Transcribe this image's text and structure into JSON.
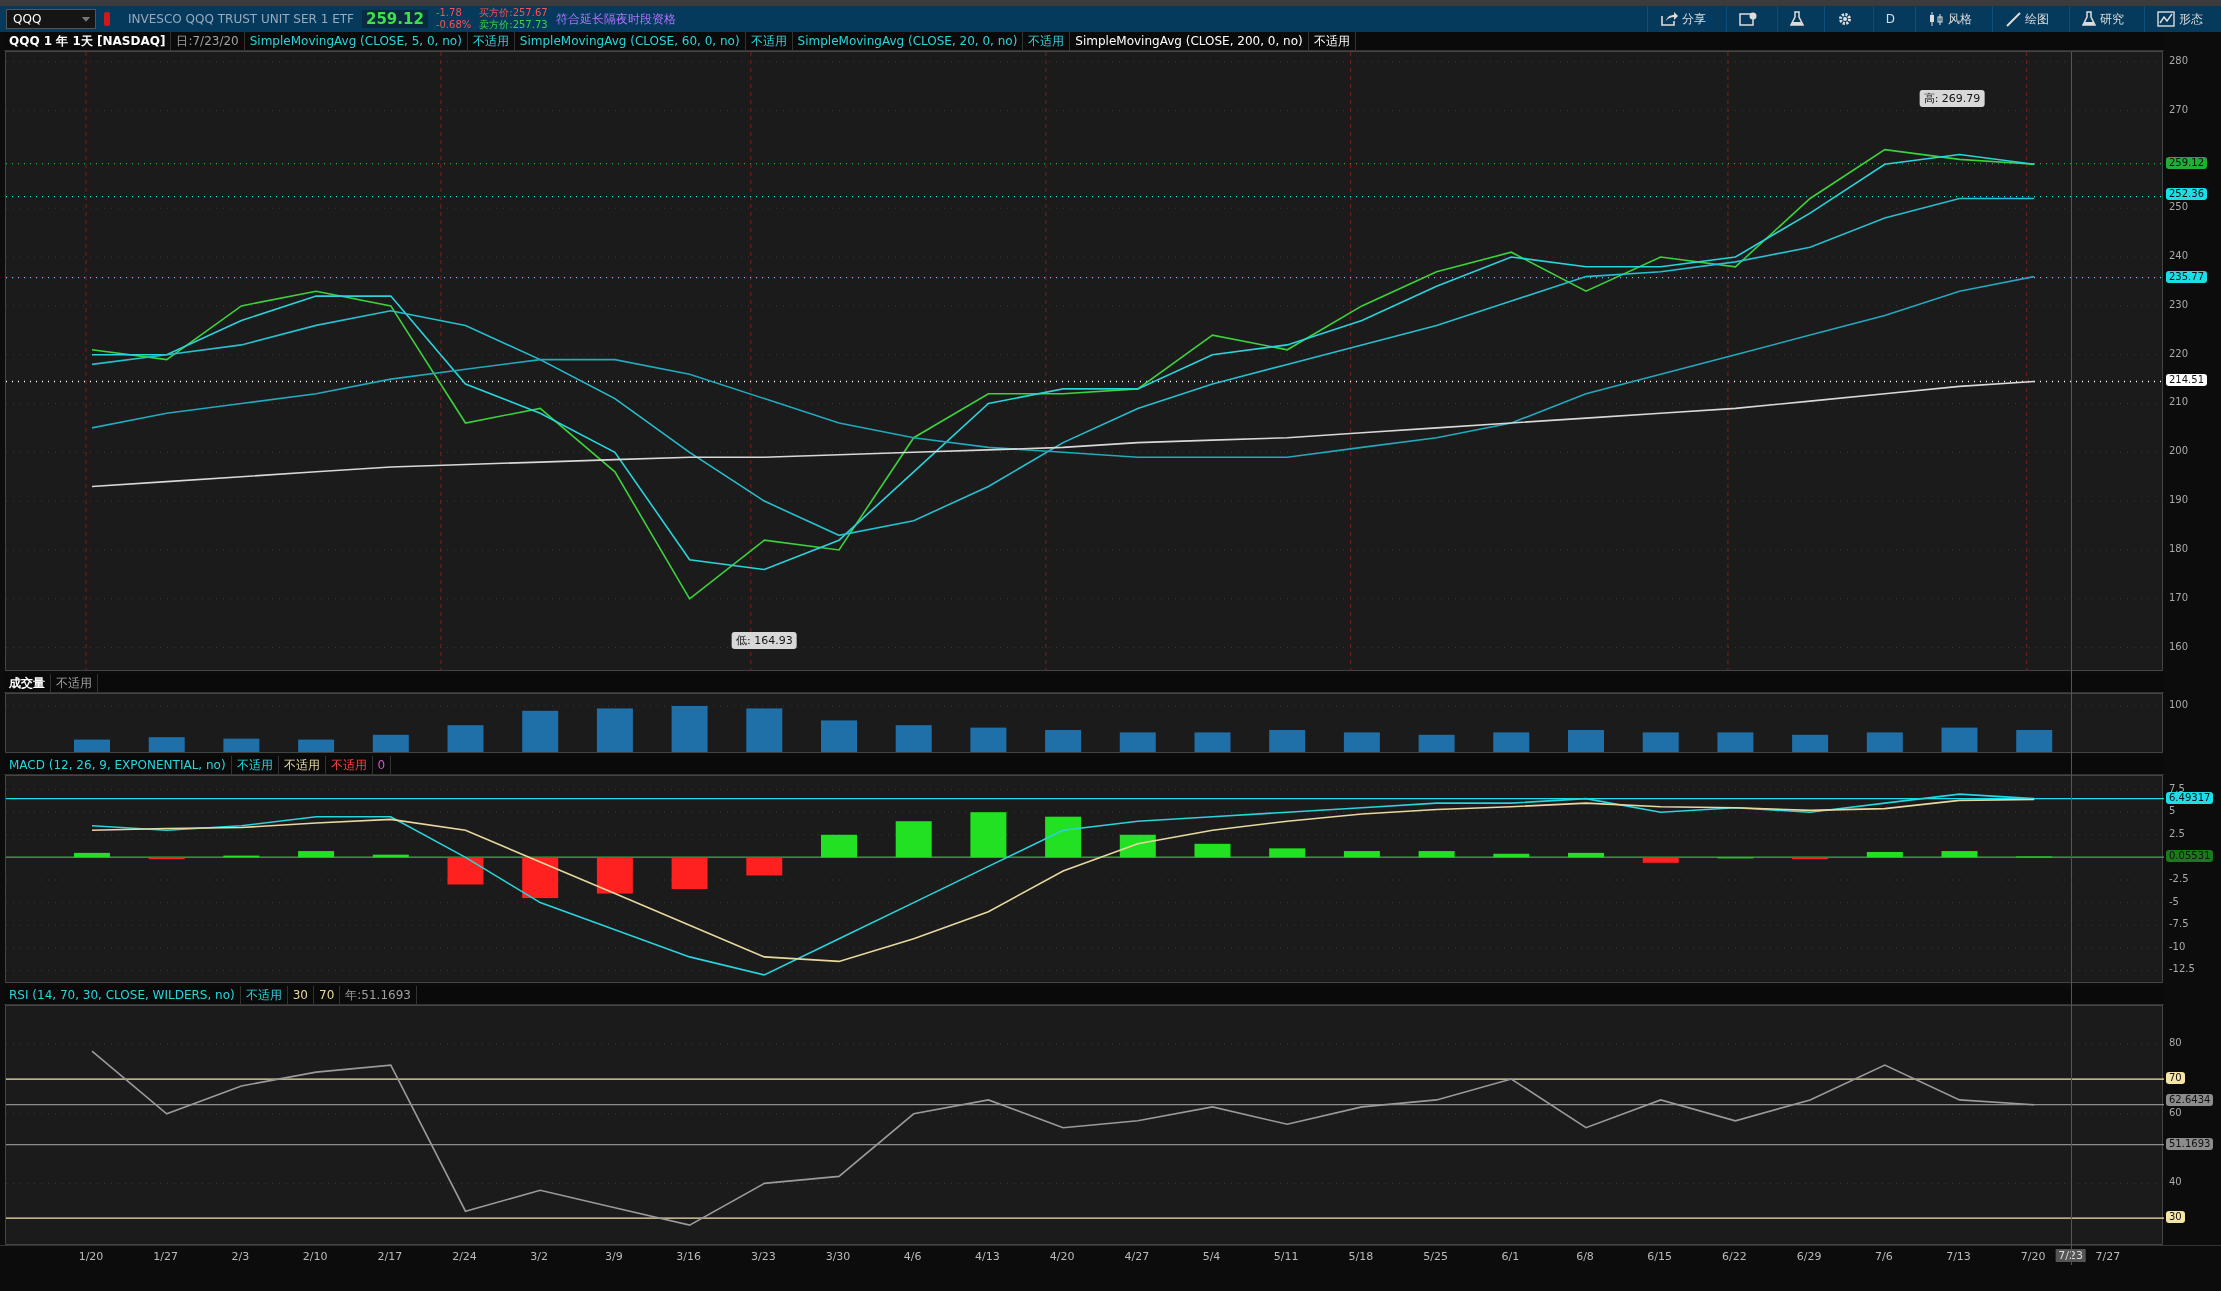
{
  "toolbar": {
    "symbol": "QQQ",
    "description": "INVESCO QQQ TRUST UNIT SER 1 ETF",
    "last": "259.12",
    "change": "-1.78",
    "change_pct": "-0.68%",
    "bid": "买方价:257.67",
    "ask": "卖方价:257.73",
    "extended_hours": "符合延长隔夜时段资格",
    "actions": [
      {
        "kind": "share",
        "label": "分享"
      },
      {
        "kind": "calendar"
      },
      {
        "kind": "flask"
      },
      {
        "kind": "gear"
      },
      {
        "kind": "text",
        "label": "D"
      },
      {
        "kind": "candles",
        "label": "风格"
      },
      {
        "kind": "pencil",
        "label": "绘图"
      },
      {
        "kind": "flask",
        "label": "研究"
      },
      {
        "kind": "pattern",
        "label": "形态"
      }
    ]
  },
  "price_panel": {
    "legend": [
      {
        "kind": "title",
        "text": "QQQ 1 年 1天 [NASDAQ]"
      },
      {
        "kind": "info",
        "text": "日:7/23/20"
      },
      {
        "kind": "study",
        "text": "SimpleMovingAvg (CLOSE, 5, 0, no)"
      },
      {
        "kind": "value",
        "text": "不适用"
      },
      {
        "kind": "study",
        "text": "SimpleMovingAvg (CLOSE, 60, 0, no)"
      },
      {
        "kind": "value",
        "text": "不适用"
      },
      {
        "kind": "study",
        "text": "SimpleMovingAvg (CLOSE, 20, 0, no)"
      },
      {
        "kind": "value",
        "text": "不适用"
      },
      {
        "kind": "plain",
        "text": "SimpleMovingAvg (CLOSE, 200, 0, no)"
      },
      {
        "kind": "plain",
        "text": "不适用"
      }
    ],
    "chart_data": {
      "type": "line",
      "grid": true,
      "ylim": [
        155,
        282
      ],
      "yticks": [
        160,
        170,
        180,
        190,
        200,
        210,
        220,
        230,
        240,
        250,
        270,
        280
      ],
      "series": [
        {
          "color": "#3cd23c",
          "values": [
            221,
            219,
            230,
            233,
            230,
            206,
            209,
            196,
            170,
            182,
            180,
            203,
            212,
            212,
            213,
            224,
            221,
            230,
            237,
            241,
            233,
            240,
            238,
            252,
            262,
            260,
            259,
            null
          ]
        },
        {
          "color": "#2ad4dc",
          "values": [
            220,
            220,
            227,
            232,
            232,
            214,
            208,
            200,
            178,
            176,
            182,
            196,
            210,
            213,
            213,
            220,
            222,
            227,
            234,
            240,
            238,
            238,
            240,
            249,
            259,
            261,
            259,
            null
          ]
        },
        {
          "color": "#27bfcf",
          "values": [
            218,
            220,
            222,
            226,
            229,
            226,
            219,
            211,
            200,
            190,
            183,
            186,
            193,
            202,
            209,
            214,
            218,
            222,
            226,
            231,
            236,
            237,
            239,
            242,
            248,
            252,
            252,
            null
          ]
        },
        {
          "color": "#22a9bd",
          "values": [
            205,
            208,
            210,
            212,
            215,
            217,
            219,
            219,
            216,
            211,
            206,
            203,
            201,
            200,
            199,
            199,
            199,
            201,
            203,
            206,
            212,
            216,
            220,
            224,
            228,
            233,
            236,
            null
          ]
        },
        {
          "color": "#d8d8d8",
          "values": [
            193,
            194,
            195,
            196,
            197,
            197.5,
            198,
            198.5,
            199,
            199,
            199.5,
            200,
            200.5,
            201,
            202,
            202.5,
            203,
            204,
            205,
            206,
            207,
            208,
            209,
            210.5,
            212,
            213.5,
            214.5,
            null
          ]
        }
      ],
      "annotations": [
        {
          "text": "高: 269.79"
        },
        {
          "text": "低: 164.93"
        }
      ],
      "ref_lines": [
        {
          "axis": "y",
          "value": 259.12,
          "label": "259.12",
          "color": "#1fae38"
        },
        {
          "axis": "y",
          "value": 252.36,
          "label": "252.36",
          "color": "#19e0e8"
        },
        {
          "axis": "y",
          "value": 235.77,
          "label": "235.77",
          "color": "#19e0e8"
        },
        {
          "axis": "y",
          "value": 214.51,
          "label": "214.51",
          "color": "#ffffff"
        }
      ]
    }
  },
  "volume_panel": {
    "legend": [
      {
        "kind": "title",
        "text": "成交量"
      },
      {
        "kind": "info",
        "text": "不适用"
      }
    ],
    "chart_data": {
      "type": "bar",
      "grid": true,
      "ylim": [
        0,
        125
      ],
      "yticks": [
        100
      ],
      "series": [
        {
          "color": "#1f6fa8",
          "values": [
            30,
            35,
            32,
            30,
            40,
            60,
            90,
            95,
            100,
            95,
            70,
            60,
            55,
            50,
            45,
            45,
            50,
            45,
            40,
            45,
            50,
            45,
            45,
            40,
            45,
            55,
            50,
            null
          ]
        }
      ]
    }
  },
  "macd_panel": {
    "legend": [
      {
        "kind": "study",
        "text": "MACD (12, 26, 9, EXPONENTIAL, no)"
      },
      {
        "kind": "value",
        "text": "不适用"
      },
      {
        "kind": "avg",
        "text": "不适用"
      },
      {
        "kind": "diff",
        "text": "不适用"
      },
      {
        "kind": "zero",
        "text": "0"
      }
    ],
    "chart_data": {
      "type": "line",
      "grid": true,
      "ylim": [
        -14,
        9
      ],
      "yticks": [
        7.5,
        5,
        2.5,
        -2.5,
        -5,
        -7.5,
        -10,
        -12.5
      ],
      "series": [
        {
          "type": "bar",
          "color": "#22e022",
          "values": [
            0.5,
            null,
            0.2,
            0.7,
            0.3,
            null,
            null,
            null,
            null,
            null,
            2.5,
            4,
            5,
            4.5,
            2.5,
            1.5,
            1,
            0.7,
            0.7,
            0.4,
            0.5,
            null,
            0,
            null,
            0.6,
            0.7,
            0.1,
            null
          ]
        },
        {
          "type": "bar",
          "color": "#ff2020",
          "values": [
            null,
            -0.2,
            null,
            null,
            null,
            -3,
            -4.5,
            -4,
            -3.5,
            -2,
            null,
            null,
            null,
            null,
            null,
            null,
            null,
            null,
            null,
            null,
            null,
            -0.6,
            null,
            -0.2,
            null,
            null,
            null,
            null
          ]
        },
        {
          "color": "#2ad4dc",
          "values": [
            3.5,
            3,
            3.5,
            4.5,
            4.5,
            0,
            -5,
            -8,
            -11,
            -13,
            -9,
            -5,
            -1,
            3,
            4,
            4.5,
            5,
            5.5,
            6,
            6,
            6.5,
            5,
            5.5,
            5,
            6,
            7,
            6.5,
            null
          ]
        },
        {
          "color": "#e8d8a0",
          "values": [
            3,
            3.2,
            3.3,
            3.8,
            4.2,
            3,
            -0.5,
            -4,
            -7.5,
            -11,
            -11.5,
            -9,
            -6,
            -1.5,
            1.5,
            3,
            4,
            4.8,
            5.3,
            5.6,
            6,
            5.6,
            5.5,
            5.2,
            5.4,
            6.3,
            6.4,
            null
          ]
        }
      ],
      "ref_lines": [
        {
          "axis": "y",
          "value": 0,
          "color": "#d050d0"
        },
        {
          "axis": "y",
          "value": 6.49317,
          "label": "6.49317",
          "color": "#19e0e8"
        },
        {
          "axis": "y",
          "value": 0.05531,
          "label": "0.05531",
          "color": "#1a7a1a"
        }
      ]
    }
  },
  "rsi_panel": {
    "legend": [
      {
        "kind": "study",
        "text": "RSI (14, 70, 30, CLOSE, WILDERS, no)"
      },
      {
        "kind": "value",
        "text": "不适用"
      },
      {
        "kind": "avg",
        "text": "30"
      },
      {
        "kind": "avg",
        "text": "70"
      },
      {
        "kind": "info",
        "text": "年:51.1693"
      }
    ],
    "chart_data": {
      "type": "line",
      "grid": true,
      "x": [
        "1/20",
        "1/27",
        "2/3",
        "2/10",
        "2/17",
        "2/24",
        "3/2",
        "3/9",
        "3/16",
        "3/23",
        "3/30",
        "4/6",
        "4/13",
        "4/20",
        "4/27",
        "5/4",
        "5/11",
        "5/18",
        "5/25",
        "6/1",
        "6/8",
        "6/15",
        "6/22",
        "6/29",
        "7/6",
        "7/13",
        "7/20",
        "7/27"
      ],
      "ylim": [
        22,
        91
      ],
      "yticks": [
        40,
        60,
        80
      ],
      "series": [
        {
          "color": "#9a9a9a",
          "values": [
            78,
            60,
            68,
            72,
            74,
            32,
            38,
            33,
            28,
            40,
            42,
            60,
            64,
            56,
            58,
            62,
            57,
            62,
            64,
            70,
            56,
            64,
            58,
            64,
            74,
            64,
            62.6,
            null
          ]
        }
      ],
      "ref_lines": [
        {
          "axis": "y",
          "value": 70,
          "label": "70",
          "color": "#f5e6a8"
        },
        {
          "axis": "y",
          "value": 62.6434,
          "label": "62.6434",
          "color": "#8c8c8c"
        },
        {
          "axis": "y",
          "value": 51.1693,
          "label": "51.1693",
          "color": "#8c8c8c"
        },
        {
          "axis": "y",
          "value": 30,
          "label": "30",
          "color": "#f5e6a8"
        }
      ]
    }
  },
  "cursor_label": "7/23"
}
